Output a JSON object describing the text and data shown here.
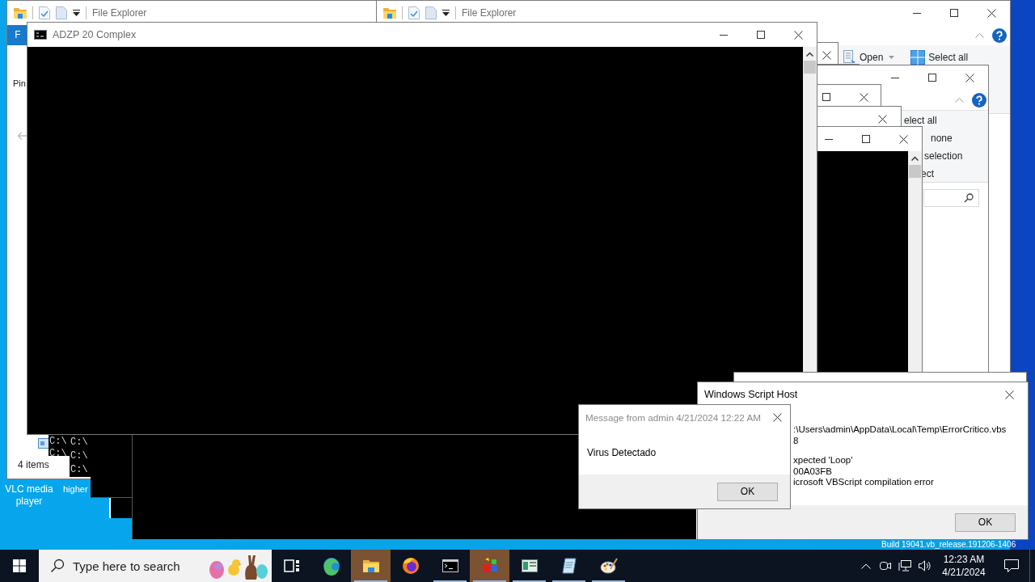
{
  "explorer_left": {
    "title": "File Explorer",
    "ribbon_tab": "F",
    "nav_label": "Pin",
    "status": "4 items"
  },
  "explorer_right": {
    "title": "File Explorer",
    "ribbon_items": [
      "Open",
      "Select all"
    ]
  },
  "explorer_behind": {
    "ribbon_items": [
      "elect all",
      "none",
      "selection",
      "ect"
    ]
  },
  "console_window": {
    "title": "ADZP 20 Complex"
  },
  "background_consoles": [
    {
      "lines": [
        "C:\\",
        "C:\\"
      ]
    },
    {
      "lines": [
        "C:\\",
        "C:\\",
        "C:\\"
      ]
    }
  ],
  "desktop_icons": [
    {
      "label": "VLC media player"
    },
    {
      "label": "higher"
    }
  ],
  "build_info": "Build 19041.vb_release.191206-1406",
  "script_error_dialog": {
    "title": "Windows Script Host",
    "groups": [
      [
        ":\\Users\\admin\\AppData\\Local\\Temp\\ErrorCritico.vbs",
        "8"
      ],
      [
        "xpected 'Loop'",
        "00A03FB",
        "icrosoft VBScript compilation error"
      ]
    ],
    "button": "OK"
  },
  "message_dialog": {
    "title": "Message from admin 4/21/2024 12:22 AM",
    "text": "Virus Detectado",
    "button": "OK"
  },
  "taskbar": {
    "search_placeholder": "Type here to search",
    "apps": [
      {
        "kind": "task-view",
        "highlighted": false,
        "running": false
      },
      {
        "kind": "swirl",
        "highlighted": false,
        "running": false
      },
      {
        "kind": "folder",
        "highlighted": true,
        "running": true
      },
      {
        "kind": "flame-globe",
        "highlighted": false,
        "running": false
      },
      {
        "kind": "terminal",
        "highlighted": false,
        "running": true
      },
      {
        "kind": "cubes",
        "highlighted": true,
        "running": true
      },
      {
        "kind": "window",
        "highlighted": false,
        "running": true
      },
      {
        "kind": "notepad",
        "highlighted": false,
        "running": true
      },
      {
        "kind": "palette",
        "highlighted": false,
        "running": true
      }
    ],
    "clock": {
      "time": "12:23 AM",
      "date": "4/21/2024"
    }
  }
}
